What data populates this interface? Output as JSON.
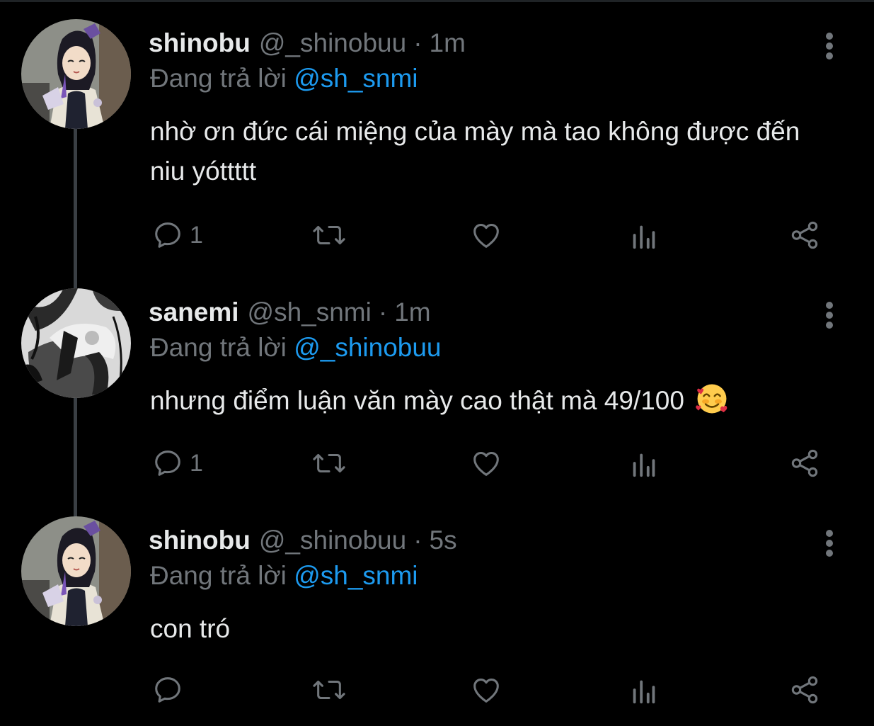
{
  "theme": {
    "background": "#000000",
    "text": "#e7e9ea",
    "muted": "#71767b",
    "accent": "#1d9bf0",
    "thread_line": "#3a3f44"
  },
  "tweets": [
    {
      "name": "shinobu",
      "handle": "@_shinobuu",
      "separator": "·",
      "time": "1m",
      "replying_prefix": "Đang trả lời",
      "replying_to": "@sh_snmi",
      "text": "nhờ ơn đức cái miệng của mày mà tao không được đến niu yóttttt",
      "reply_count": "1",
      "avatar_icon": "shinobu-avatar"
    },
    {
      "name": "sanemi",
      "handle": "@sh_snmi",
      "separator": "·",
      "time": "1m",
      "replying_prefix": "Đang trả lời",
      "replying_to": "@_shinobuu",
      "text": "nhưng điểm luận văn mày cao thật mà 49/100",
      "emoji": "smiling-face-with-hearts-icon",
      "reply_count": "1",
      "avatar_icon": "sanemi-avatar"
    },
    {
      "name": "shinobu",
      "handle": "@_shinobuu",
      "separator": "·",
      "time": "5s",
      "replying_prefix": "Đang trả lời",
      "replying_to": "@sh_snmi",
      "text": "con tró",
      "reply_count": "",
      "avatar_icon": "shinobu-avatar"
    }
  ],
  "action_icons": [
    "reply-icon",
    "retweet-icon",
    "like-icon",
    "analytics-icon",
    "share-icon"
  ]
}
